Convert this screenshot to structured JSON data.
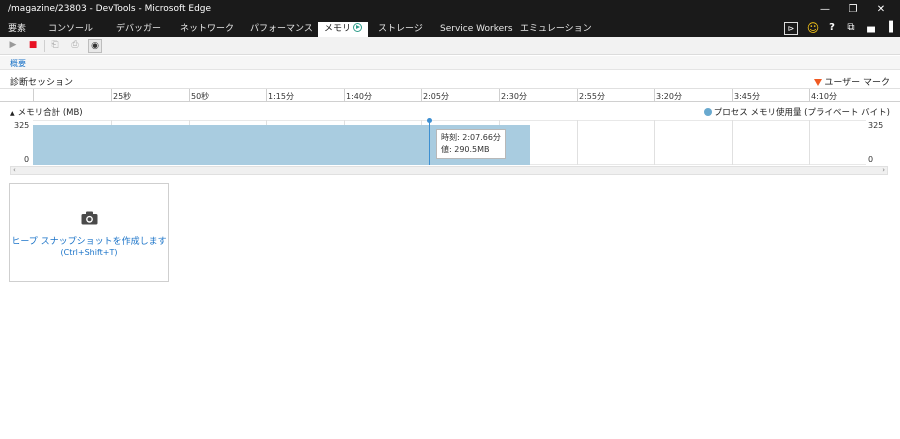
{
  "window": {
    "title": "/magazine/23803 - DevTools - Microsoft Edge",
    "minimize_glyph": "—",
    "restore_glyph": "❐",
    "close_glyph": "✕"
  },
  "tabs": [
    {
      "label": "要素"
    },
    {
      "label": "コンソール"
    },
    {
      "label": "デバッガー"
    },
    {
      "label": "ネットワーク"
    },
    {
      "label": "パフォーマンス"
    },
    {
      "label": "メモリ",
      "active": true
    },
    {
      "label": "ストレージ"
    },
    {
      "label": "Service Workers"
    },
    {
      "label": "エミュレーション"
    }
  ],
  "tab_icons": {
    "console_glyph": "⊳",
    "smiley_glyph": "☺",
    "help_glyph": "?",
    "windows_glyph": "⧉",
    "dock_bottom_glyph": "▄",
    "dock_right_glyph": "▐"
  },
  "toolbar": {
    "play_glyph": "▶",
    "stop_glyph": "■",
    "import_glyph": "⎗",
    "export_glyph": "⎙",
    "camera_glyph": "◉"
  },
  "subnav": {
    "summary_link": "概要"
  },
  "session": {
    "label": "診断セッション",
    "user_mark": "ユーザー マーク"
  },
  "ruler": {
    "ticks": [
      "25秒",
      "50秒",
      "1:15分",
      "1:40分",
      "2:05分",
      "2:30分",
      "2:55分",
      "3:20分",
      "3:45分",
      "4:10分"
    ]
  },
  "graph": {
    "title": "メモリ合計 (MB)",
    "legend": "プロセス メモリ使用量 (プライベート バイト)",
    "y_max": "325",
    "y_min": "0",
    "tooltip": {
      "time": "時刻: 2:07.66分",
      "value": "値: 290.5MB"
    },
    "area_color": "#a9cce0",
    "cursor_color": "#3d8fd1"
  },
  "chart_data": {
    "type": "area",
    "ylabel": "メモリ合計 (MB)",
    "ylim": [
      0,
      325
    ],
    "x_ticks": [
      "25秒",
      "50秒",
      "1:15分",
      "1:40分",
      "2:05分",
      "2:30分",
      "2:55分",
      "3:20分",
      "3:45分",
      "4:10分"
    ],
    "series": [
      {
        "name": "プロセス メモリ使用量 (プライベート バイト)",
        "value_mb": 290.5
      }
    ],
    "cursor": {
      "time": "2:07.66分",
      "value_mb": 290.5
    }
  },
  "scrollbar": {
    "left_glyph": "‹",
    "right_glyph": "›"
  },
  "snapshot": {
    "line1": "ヒープ スナップショットを作成します",
    "line2": "(Ctrl+Shift+T)"
  }
}
